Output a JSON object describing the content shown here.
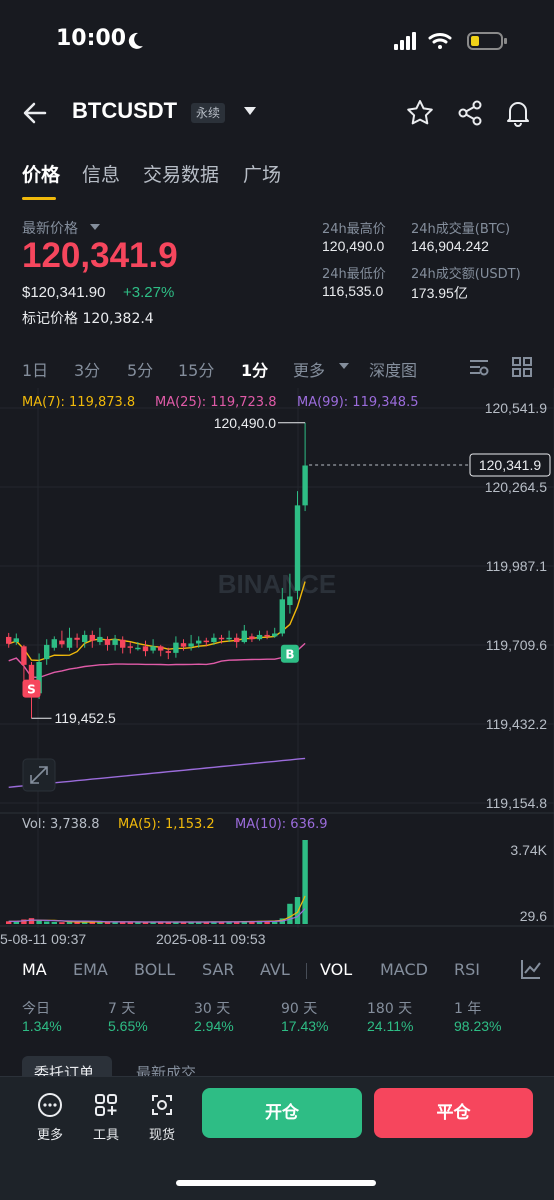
{
  "status_bar": {
    "time": "10:00"
  },
  "header": {
    "symbol": "BTCUSDT",
    "badge": "永续"
  },
  "tabs": [
    {
      "label": "价格",
      "active": true
    },
    {
      "label": "信息"
    },
    {
      "label": "交易数据"
    },
    {
      "label": "广场"
    }
  ],
  "price": {
    "last_label": "最新价格",
    "last": "120,341.9",
    "usd": "$120,341.90",
    "change": "+3.27%",
    "mark_label": "标记价格",
    "mark": "120,382.4"
  },
  "stats": {
    "high_label": "24h最高价",
    "high": "120,490.0",
    "low_label": "24h最低价",
    "low": "116,535.0",
    "vol_btc_label": "24h成交量(BTC)",
    "vol_btc": "146,904.242",
    "vol_usdt_label": "24h成交额(USDT)",
    "vol_usdt": "173.95亿"
  },
  "intervals": [
    "1日",
    "3分",
    "5分",
    "15分",
    "1分",
    "更多",
    "深度图"
  ],
  "active_interval": "1分",
  "chart_header": {
    "ma7": "MA(7): 119,873.8",
    "ma25": "MA(25): 119,723.8",
    "ma99": "MA(99): 119,348.5"
  },
  "vol_header": {
    "vol": "Vol: 3,738.8",
    "ma5": "MA(5): 1,153.2",
    "ma10": "MA(10): 636.9"
  },
  "chart_data": {
    "type": "candlestick",
    "y_ticks": [
      "120,541.9",
      "120,264.5",
      "119,987.1",
      "119,709.6",
      "119,432.2",
      "119,154.8"
    ],
    "current_price_tag": "120,341.9",
    "high_annotation": "120,490.0",
    "low_annotation": "119,452.5",
    "vol_ticks": [
      "3.74K",
      "29.6"
    ],
    "x_ticks": [
      "5-08-11 09:37",
      "2025-08-11 09:53"
    ],
    "watermark": "BINANCE",
    "marker_s": "S",
    "marker_b": "B",
    "candles": [
      [
        119738,
        119714,
        119752,
        119700
      ],
      [
        119720,
        119733,
        119750,
        119710
      ],
      [
        119705,
        119640,
        119710,
        119540
      ],
      [
        119640,
        119540,
        119650,
        119452
      ],
      [
        119540,
        119650,
        119680,
        119520
      ],
      [
        119660,
        119710,
        119730,
        119640
      ],
      [
        119700,
        119730,
        119740,
        119690
      ],
      [
        119725,
        119712,
        119760,
        119700
      ],
      [
        119700,
        119735,
        119770,
        119690
      ],
      [
        119735,
        119728,
        119750,
        119700
      ],
      [
        119720,
        119745,
        119760,
        119700
      ],
      [
        119745,
        119725,
        119760,
        119700
      ],
      [
        119720,
        119738,
        119770,
        119710
      ],
      [
        119730,
        119710,
        119740,
        119690
      ],
      [
        119710,
        119730,
        119745,
        119690
      ],
      [
        119728,
        119700,
        119740,
        119680
      ],
      [
        119705,
        119700,
        119720,
        119680
      ],
      [
        119700,
        119700,
        119720,
        119690
      ],
      [
        119705,
        119688,
        119725,
        119670
      ],
      [
        119690,
        119705,
        119730,
        119680
      ],
      [
        119705,
        119690,
        119710,
        119670
      ],
      [
        119688,
        119682,
        119700,
        119660
      ],
      [
        119682,
        119718,
        119740,
        119665
      ],
      [
        119716,
        119704,
        119730,
        119690
      ],
      [
        119704,
        119715,
        119745,
        119690
      ],
      [
        119715,
        119725,
        119740,
        119700
      ],
      [
        119725,
        119720,
        119735,
        119705
      ],
      [
        119720,
        119735,
        119750,
        119710
      ],
      [
        119735,
        119730,
        119745,
        119715
      ],
      [
        119730,
        119735,
        119760,
        119720
      ],
      [
        119735,
        119720,
        119750,
        119700
      ],
      [
        119720,
        119760,
        119780,
        119715
      ],
      [
        119740,
        119730,
        119750,
        119720
      ],
      [
        119730,
        119745,
        119760,
        119725
      ],
      [
        119745,
        119740,
        119760,
        119730
      ],
      [
        119740,
        119750,
        119770,
        119735
      ],
      [
        119750,
        119870,
        119910,
        119740
      ],
      [
        119850,
        119880,
        119960,
        119820
      ],
      [
        119900,
        120200,
        120250,
        119870
      ],
      [
        120200,
        120340,
        120490,
        120180
      ]
    ],
    "volumes": [
      120,
      110,
      200,
      260,
      150,
      110,
      90,
      80,
      100,
      90,
      85,
      95,
      110,
      90,
      80,
      100,
      85,
      90,
      80,
      95,
      90,
      85,
      90,
      80,
      95,
      100,
      90,
      95,
      90,
      100,
      110,
      130,
      120,
      140,
      130,
      150,
      250,
      900,
      1200,
      3738
    ]
  },
  "indicators": [
    "MA",
    "EMA",
    "BOLL",
    "SAR",
    "AVL",
    "VOL",
    "MACD",
    "RSI"
  ],
  "performance": [
    {
      "label": "今日",
      "value": "1.34%"
    },
    {
      "label": "7 天",
      "value": "5.65%"
    },
    {
      "label": "30 天",
      "value": "2.94%"
    },
    {
      "label": "90 天",
      "value": "17.43%"
    },
    {
      "label": "180 天",
      "value": "24.11%"
    },
    {
      "label": "1 年",
      "value": "98.23%"
    }
  ],
  "order_tabs": [
    "委托订单",
    "最新成交"
  ],
  "tools": [
    {
      "label": "更多",
      "icon": "more-icon"
    },
    {
      "label": "工具",
      "icon": "tools-icon"
    },
    {
      "label": "现货",
      "icon": "spot-icon"
    }
  ],
  "buttons": {
    "open": "开仓",
    "close": "平仓"
  },
  "colors": {
    "up": "#2ebd85",
    "down": "#f6465d",
    "accent": "#f0b90b",
    "ma7": "#f0b90b",
    "ma25": "#e05ba8",
    "ma99": "#9b6cdb"
  }
}
